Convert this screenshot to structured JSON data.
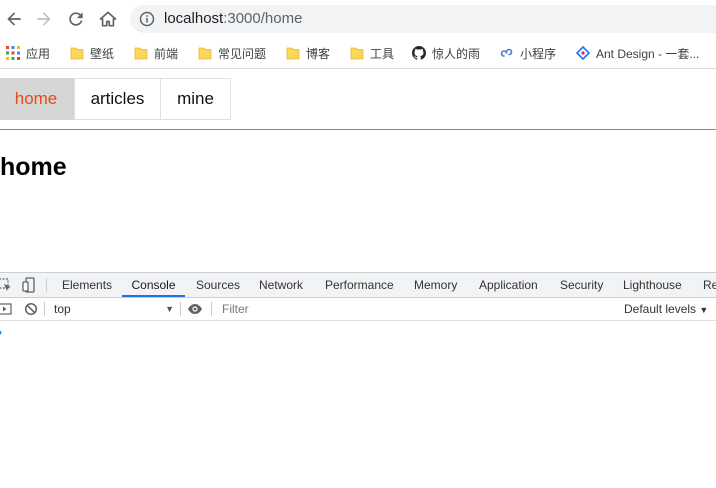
{
  "browser": {
    "url_host": "localhost",
    "url_rest": ":3000/home",
    "icons": {
      "back": "arrow-left-icon",
      "forward": "arrow-right-icon",
      "reload": "reload-icon",
      "home": "home-icon",
      "info": "info-icon"
    }
  },
  "bookmarks": [
    {
      "label": "应用",
      "icon": "apps-grid-icon"
    },
    {
      "label": "壁纸",
      "icon": "folder-icon"
    },
    {
      "label": "前端",
      "icon": "folder-icon"
    },
    {
      "label": "常见问题",
      "icon": "folder-icon"
    },
    {
      "label": "博客",
      "icon": "folder-icon"
    },
    {
      "label": "工具",
      "icon": "folder-icon"
    },
    {
      "label": "惊人的雨",
      "icon": "github-icon"
    },
    {
      "label": "小程序",
      "icon": "miniprogram-icon"
    },
    {
      "label": "Ant Design - 一套...",
      "icon": "ant-design-icon"
    }
  ],
  "page": {
    "nav": [
      "home",
      "articles",
      "mine"
    ],
    "active_nav": "home",
    "heading": "home",
    "colors": {
      "active_tab_bg": "#d6d6d6",
      "active_tab_text": "#e64a19"
    }
  },
  "devtools": {
    "tabs": [
      "Elements",
      "Console",
      "Sources",
      "Network",
      "Performance",
      "Memory",
      "Application",
      "Security",
      "Lighthouse",
      "Re"
    ],
    "active_tab": "Console",
    "context": "top",
    "filter_placeholder": "Filter",
    "levels": "Default levels",
    "prompt": "›",
    "accent": "#1a73e8"
  }
}
